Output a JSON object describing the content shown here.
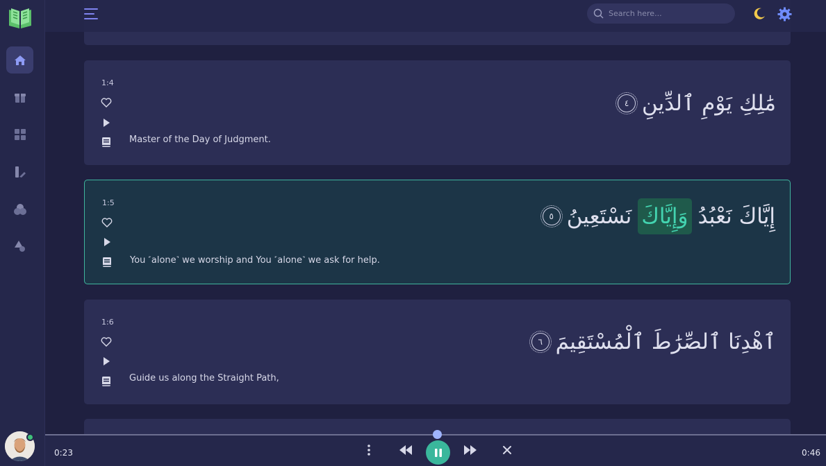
{
  "search": {
    "placeholder": "Search here..."
  },
  "verses": [
    {
      "number": "1:4",
      "arabic_words": [
        "مَٰلِكِ",
        "يَوْمِ",
        "ٱلدِّينِ"
      ],
      "marker": "٤",
      "translation": "Master of the Day of Judgment."
    },
    {
      "number": "1:5",
      "arabic_words": [
        "إِيَّاكَ",
        "نَعْبُدُ",
        "وَإِيَّاكَ",
        "نَسْتَعِينُ"
      ],
      "marker": "٥",
      "translation": "You ˹alone˺ we worship and You ˹alone˺ we ask for help."
    },
    {
      "number": "1:6",
      "arabic_words": [
        "ٱهْدِنَا",
        "ٱلصِّرَٰطَ",
        "ٱلْمُسْتَقِيمَ"
      ],
      "marker": "٦",
      "translation": "Guide us along the Straight Path,"
    }
  ],
  "player": {
    "current_time": "0:23",
    "total_time": "0:46",
    "progress": 0.5
  },
  "colors": {
    "accent": "#3ab79c",
    "highlight": "#43d4b0",
    "background": "#1f2040",
    "card": "#2c2e55"
  }
}
